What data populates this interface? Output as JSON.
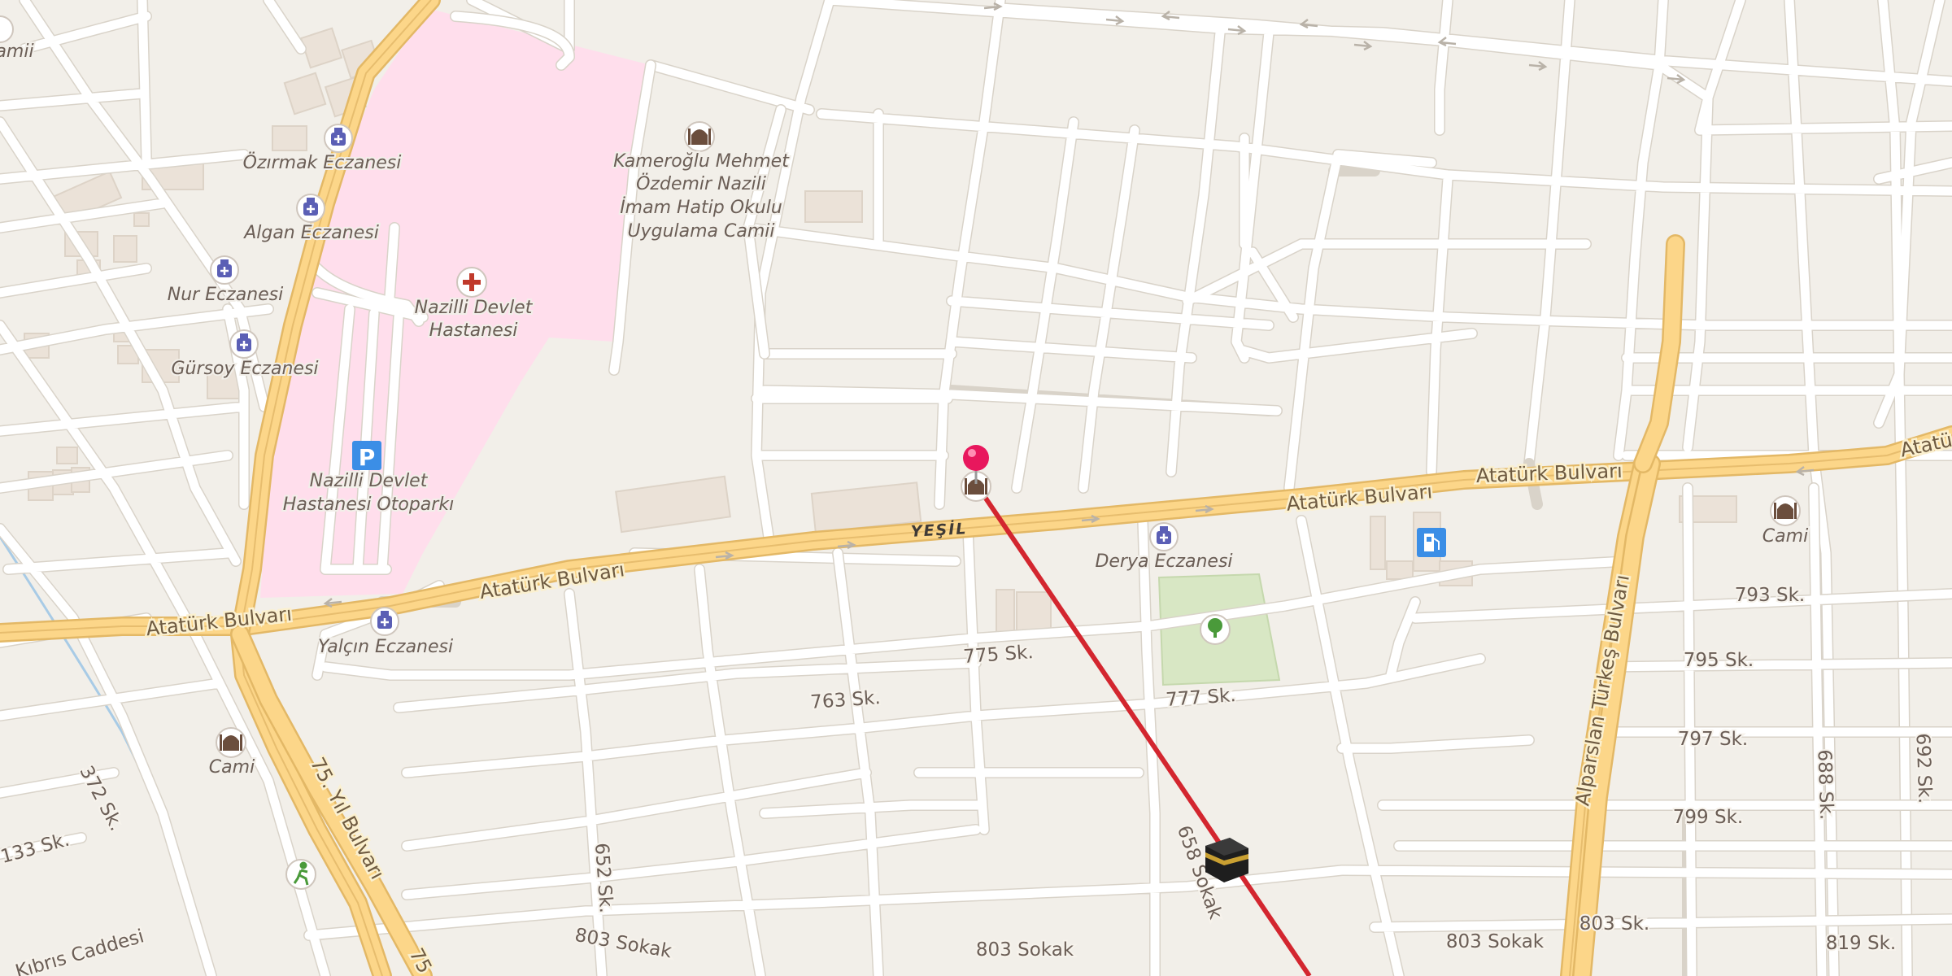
{
  "map": {
    "colors": {
      "background": "#f2efe9",
      "hospital_area": "#ffdeec",
      "park": "#d8e7c4",
      "major_road": "#fcd689",
      "route_line": "#d3262f",
      "pin": "#e8175d",
      "pharmacy_icon": "#5b5fb5",
      "parking_icon": "#3b8ee6",
      "fuel_icon": "#3b8ee6",
      "hospital_icon": "#c0392b"
    },
    "district_label": "YEŞİL",
    "labels": {
      "atatürk_west": "Atatürk Bulvarı",
      "atatürk_mid": "Atatürk Bulvarı",
      "atatürk_center": "Atatürk Bulvarı",
      "atatürk_east": "Atatürk Bulvarı",
      "atatürk_edge": "Atatü",
      "yil_bulvari": "75. Yıl Bulvarı",
      "yil_bulvari_bottom": "75",
      "turkes": "Alparslan Türkeş Bulvarı",
      "s372": "372 Sk.",
      "s133": "133 Sk.",
      "kibris": "Kıbrıs Caddesi",
      "s652": "652 Sk.",
      "s803_a": "803 Sokak",
      "s803_b": "803 Sokak",
      "s803_c": "803 Sokak",
      "s803_d": "803 Sk.",
      "s819": "819 Sk.",
      "s775": "775 Sk.",
      "s763": "763 Sk.",
      "s777": "777 Sk.",
      "s658": "658 Sokak",
      "s793": "793 Sk.",
      "s795": "795 Sk.",
      "s797": "797 Sk.",
      "s799": "799 Sk.",
      "s688": "688 Sk.",
      "s692": "692 Sk."
    },
    "pois": [
      {
        "name": "Özırmak Eczanesi",
        "type": "pharmacy-icon"
      },
      {
        "name": "Algan Eczanesi",
        "type": "pharmacy-icon"
      },
      {
        "name": "Nur Eczanesi",
        "type": "pharmacy-icon"
      },
      {
        "name": "Gürsoy Eczanesi",
        "type": "pharmacy-icon"
      },
      {
        "name": "Yalçın Eczanesi",
        "type": "pharmacy-icon"
      },
      {
        "name": "Derya Eczanesi",
        "type": "pharmacy-icon"
      },
      {
        "name": "Nazilli Devlet",
        "name2": "Hastanesi",
        "type": "hospital-icon"
      },
      {
        "name": "Nazilli Devlet",
        "name2": "Hastanesi Otoparkı",
        "type": "parking-icon"
      },
      {
        "name": "Kameroğlu Mehmet",
        "name2": "Özdemir Nazili",
        "name3": "İmam Hatip Okulu",
        "name4": "Uygulama Camii",
        "type": "mosque-icon"
      },
      {
        "name": "Cami",
        "type": "mosque-icon"
      },
      {
        "name": "Cami",
        "type": "mosque-icon"
      },
      {
        "name": "amii",
        "type": "mosque-icon"
      }
    ]
  }
}
